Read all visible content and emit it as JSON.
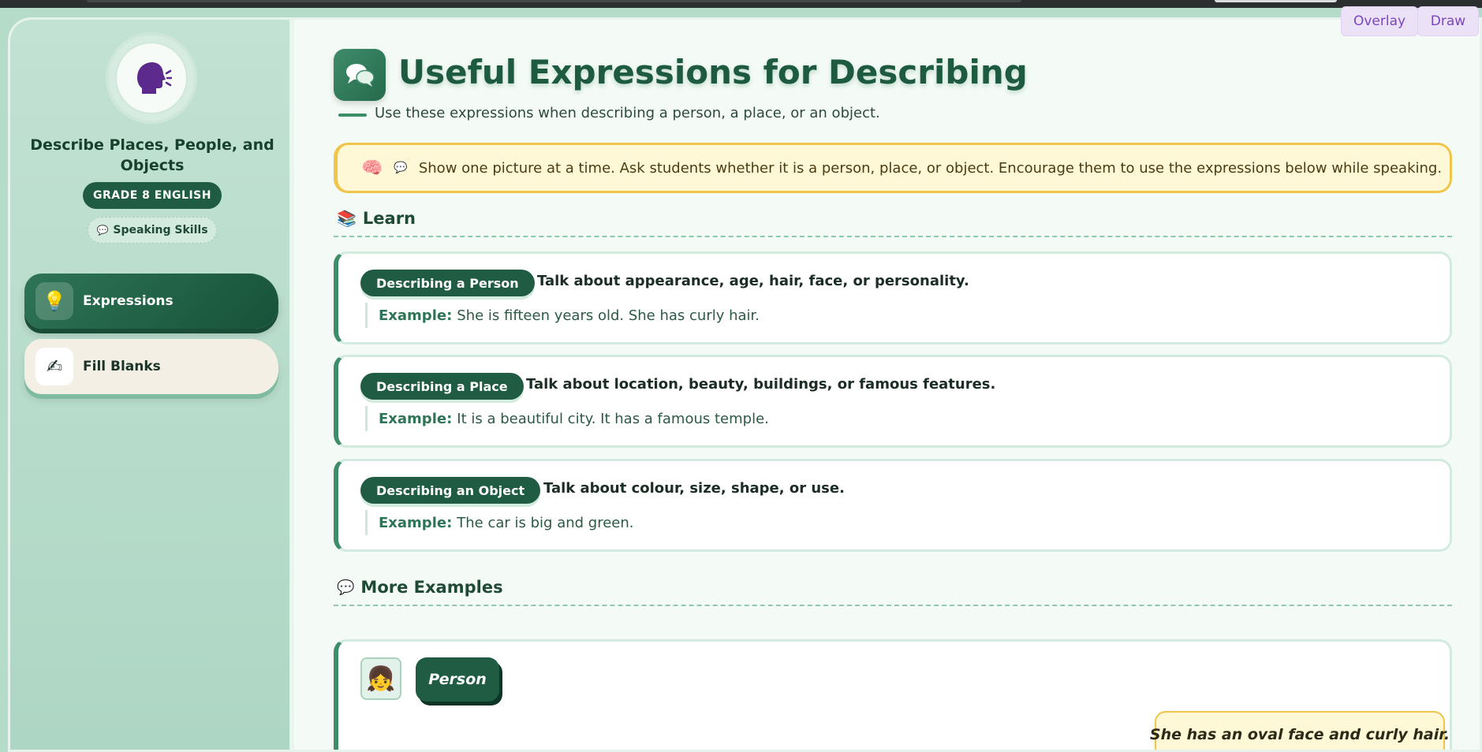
{
  "sidebar": {
    "title": "Describe Places, People, and Objects",
    "grade": "GRADE 8 ENGLISH",
    "skill": "Speaking Skills",
    "nav": [
      {
        "label": "Expressions",
        "icon": "lightbulb-icon",
        "active": true
      },
      {
        "label": "Fill Blanks",
        "icon": "writing-hand-icon",
        "active": false
      }
    ]
  },
  "header": {
    "title": "Useful Expressions for Describing",
    "subtitle": "Use these expressions when describing a person, a place, or an object."
  },
  "tip": {
    "text": "Show one picture at a time. Ask students whether it is a person, place, or object. Encourage them to use the expressions below while speaking."
  },
  "learn": {
    "heading": "Learn",
    "cards": [
      {
        "tag": "Describing a Person",
        "desc": "Talk about appearance, age, hair, face, or personality.",
        "example_label": "Example:",
        "example": "She is fifteen years old. She has curly hair."
      },
      {
        "tag": "Describing a Place",
        "desc": "Talk about location, beauty, buildings, or famous features.",
        "example_label": "Example:",
        "example": "It is a beautiful city. It has a famous temple."
      },
      {
        "tag": "Describing an Object",
        "desc": "Talk about colour, size, shape, or use.",
        "example_label": "Example:",
        "example": "The car is big and green."
      }
    ]
  },
  "more_examples": {
    "heading": "More Examples",
    "items": [
      {
        "tag": "Person",
        "sentence": "She has an oval face and curly hair.",
        "icon": "girl-avatar-icon"
      }
    ]
  },
  "tools": {
    "overlay": "Overlay",
    "draw": "Draw"
  },
  "colors": {
    "primary": "#1f5c43",
    "accent": "#3f8c69",
    "tip_border": "#efc54a",
    "background": "#f4fbf7"
  }
}
